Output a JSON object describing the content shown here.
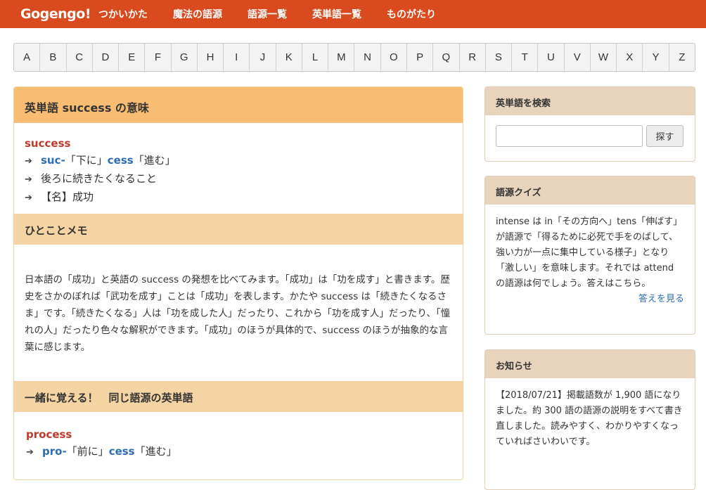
{
  "nav": {
    "logo": "Gogengo!",
    "links": [
      "つかいかた",
      "魔法の語源",
      "語源一覧",
      "英単語一覧",
      "ものがたり"
    ]
  },
  "alphabet": [
    "A",
    "B",
    "C",
    "D",
    "E",
    "F",
    "G",
    "H",
    "I",
    "J",
    "K",
    "L",
    "M",
    "N",
    "O",
    "P",
    "Q",
    "R",
    "S",
    "T",
    "U",
    "V",
    "W",
    "X",
    "Y",
    "Z"
  ],
  "main": {
    "title": "英単語 success の意味",
    "word": "success",
    "breakdown": {
      "prefix": "suc-",
      "prefix_meaning": "「下に」",
      "stem": "cess",
      "stem_meaning": "「進む」"
    },
    "meaning_line": "後ろに続きたくなること",
    "definition": "【名】成功",
    "memo_title": "ひとことメモ",
    "memo_text": "日本語の「成功」と英語の success の発想を比べてみます。「成功」は「功を成す」と書きます。歴史をさかのぼれば「武功を成す」ことは「成功」を表します。かたや success は「続きたくなるさま」です。「続きたくなる」人は「功を成した人」だったり、これから「功を成す人」だったり、「憧れの人」だったり色々な解釈ができます。「成功」のほうが具体的で、success のほうが抽象的な言葉に感じます。",
    "same_root_title": "一緒に覚える！　同じ語源の英単語",
    "same_root_word": "process",
    "same_root_breakdown": {
      "prefix": "pro-",
      "prefix_meaning": "「前に」",
      "stem": "cess",
      "stem_meaning": "「進む」"
    }
  },
  "sidebar": {
    "search_title": "英単語を検索",
    "search_button": "探す",
    "search_value": "",
    "quiz_title": "語源クイズ",
    "quiz_text": "intense は in「その方向へ」tens「伸ばす」が語源で「得るために必死で手をのばして、強い力が一点に集中している様子」となり「激しい」を意味します。それでは attend の語源は何でしょう。答えはこちら。",
    "quiz_link": "答えを見る",
    "news_title": "お知らせ",
    "news_text": "【2018/07/21】掲載語数が 1,900 語になりました。約 300 語の語源の説明をすべて書き直しました。読みやすく、わかりやすくなっていればさいわいです。"
  },
  "colors": {
    "nav_bg": "#d94a1e",
    "main_header_bg": "#f8bd72",
    "subheader_bg": "#f5d4a3",
    "side_header_bg": "#e8d3bc",
    "word_color": "#c0392b",
    "root_color": "#2d6db4"
  }
}
